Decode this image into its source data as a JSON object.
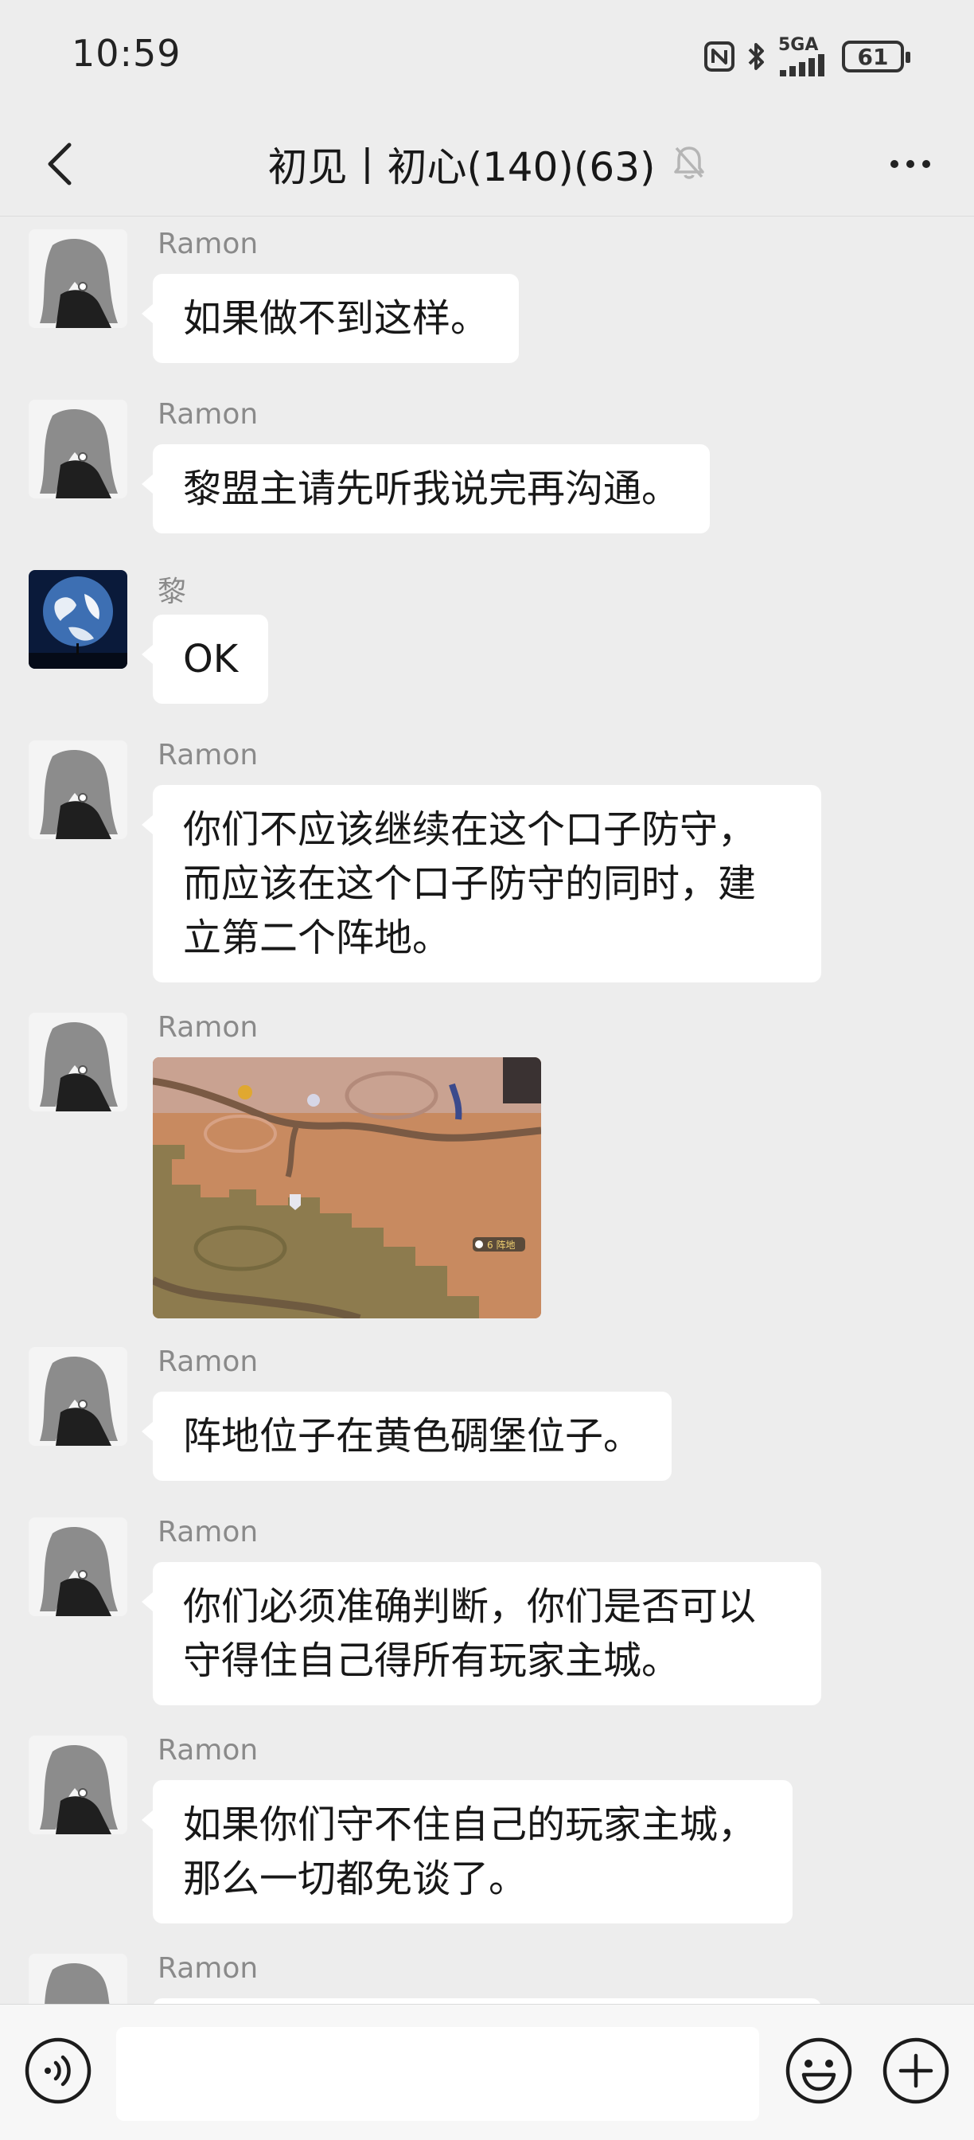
{
  "status_bar": {
    "time": "10:59",
    "network": "5GA",
    "battery": "61",
    "icons": [
      "nfc-icon",
      "bluetooth-icon",
      "signal-icon",
      "battery-icon"
    ]
  },
  "header": {
    "title": "初见丨初心(140)(63)",
    "icons": [
      "back-chevron-icon",
      "muted-bell-icon",
      "more-dots-icon"
    ]
  },
  "messages": [
    {
      "sender": "Ramon",
      "avatar": "anime-girl-avatar",
      "text": "如果做不到这样。"
    },
    {
      "sender": "Ramon",
      "avatar": "anime-girl-avatar",
      "text": "黎盟主请先听我说完再沟通。"
    },
    {
      "sender": "黎",
      "avatar": "earth-avatar",
      "text": "OK"
    },
    {
      "sender": "Ramon",
      "avatar": "anime-girl-avatar",
      "text": "你们不应该继续在这个口子防守，而应该在这个口子防守的同时，建立第二个阵地。"
    },
    {
      "sender": "Ramon",
      "avatar": "anime-girl-avatar",
      "image": "game-map-screenshot",
      "image_label": "6 阵地"
    },
    {
      "sender": "Ramon",
      "avatar": "anime-girl-avatar",
      "text": "阵地位子在黄色碉堡位子。"
    },
    {
      "sender": "Ramon",
      "avatar": "anime-girl-avatar",
      "text": "你们必须准确判断，你们是否可以守得住自己得所有玩家主城。"
    },
    {
      "sender": "Ramon",
      "avatar": "anime-girl-avatar",
      "text": "如果你们守不住自己的玩家主城，那么一切都免谈了。"
    },
    {
      "sender": "Ramon",
      "avatar": "anime-girl-avatar",
      "text": ""
    }
  ],
  "input_bar": {
    "placeholder": "",
    "icons": [
      "voice-icon",
      "emoji-icon",
      "plus-icon"
    ]
  },
  "colors": {
    "background": "#ededed",
    "bubble": "#ffffff",
    "sender_name": "#8a8a8a",
    "input_bar": "#f7f7f7"
  }
}
